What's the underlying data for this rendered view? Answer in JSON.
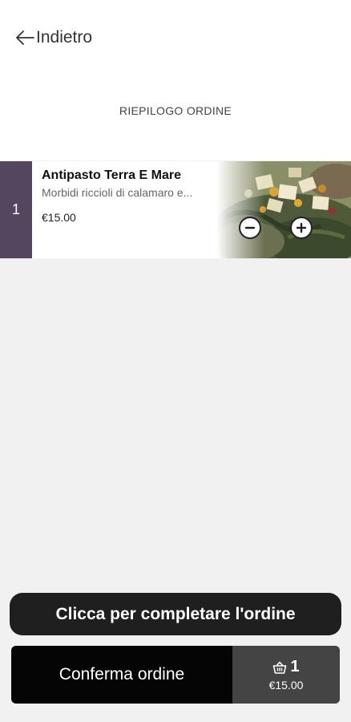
{
  "header": {
    "back_label": "Indietro",
    "title": "RIEPILOGO ORDINE"
  },
  "order_items": [
    {
      "quantity": "1",
      "name": "Antipasto Terra E Mare",
      "description": "Morbidi riccioli di calamaro e...",
      "price": "€15.00",
      "image": "salad-food-photo"
    }
  ],
  "actions": {
    "complete_label": "Clicca per completare l'ordine",
    "confirm_label": "Conferma ordine"
  },
  "cart": {
    "count": "1",
    "total": "€15.00",
    "icon": "basket-icon"
  },
  "colors": {
    "quantity_bar": "#55465f",
    "complete_button": "#1f1f1f",
    "confirm_bar": "#050505",
    "cart_box": "#444444"
  }
}
